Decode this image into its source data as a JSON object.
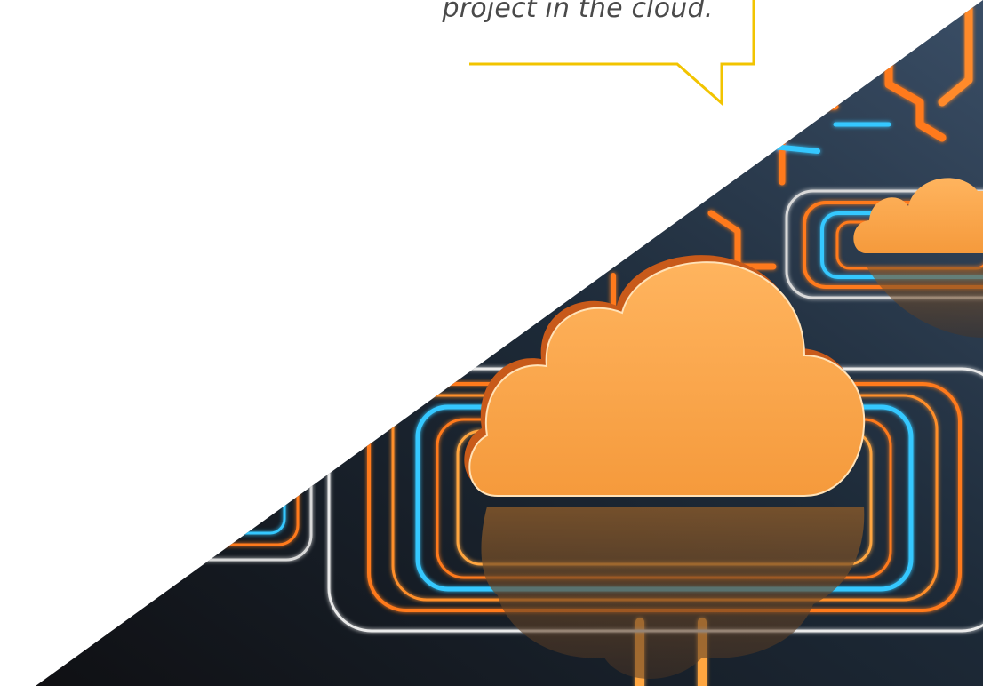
{
  "speech_bubble": {
    "text": "project in the cloud.",
    "border_color": "#f2c400"
  },
  "illustration": {
    "subject": "glowing orange cloud icons on circuit-board tiles",
    "icon": "cloud-icon",
    "colors": {
      "cloud_fill": "#f9a54a",
      "circuit_orange": "#ff7a1a",
      "circuit_cyan": "#35c8ff",
      "tile_outline": "#e6e6e6",
      "background_dark": "#1b2633",
      "background_page": "#ffffff"
    }
  }
}
